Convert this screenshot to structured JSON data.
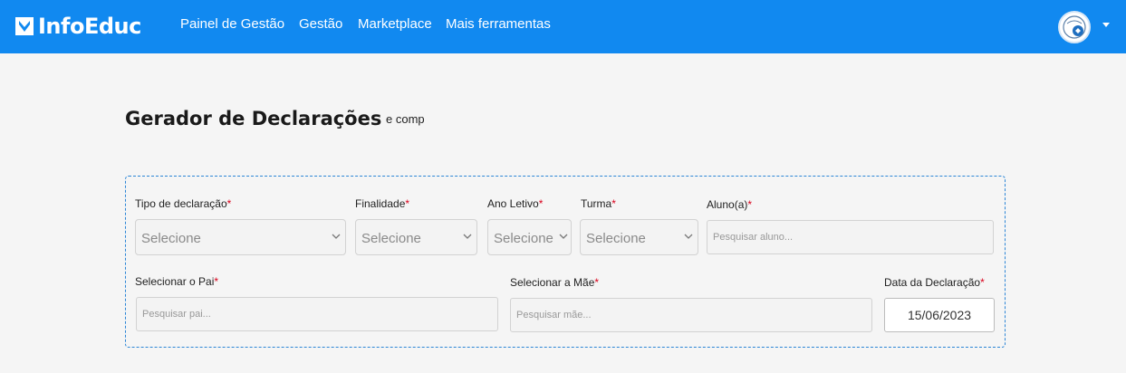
{
  "colors": {
    "navbar": "#1189f0",
    "required_mark": "#d9001b",
    "form_border": "#2b85d6"
  },
  "brand": {
    "name": "InfoEduc",
    "icon": "infoeduc-logo-icon"
  },
  "nav": {
    "links": [
      "Painel de Gestão",
      "Gestão",
      "Marketplace",
      "Mais ferramentas"
    ],
    "avatar_icon": "user-avatar-icon",
    "menu_icon": "caret-down-icon"
  },
  "page": {
    "title": "Gerador de Declarações",
    "subtitle": "e comp"
  },
  "form": {
    "required_mark": "*",
    "tipo": {
      "label": "Tipo de declaração",
      "value": "Selecione"
    },
    "finalidade": {
      "label": "Finalidade",
      "value": "Selecione"
    },
    "ano": {
      "label": "Ano Letivo",
      "value": "Selecione"
    },
    "turma": {
      "label": "Turma",
      "value": "Selecione"
    },
    "aluno": {
      "label": "Aluno(a)",
      "placeholder": "Pesquisar aluno..."
    },
    "pai": {
      "label": "Selecionar o Pai",
      "placeholder": "Pesquisar pai..."
    },
    "mae": {
      "label": "Selecionar a Mãe",
      "placeholder": "Pesquisar mãe..."
    },
    "data": {
      "label": "Data da Declaração",
      "value": "15/06/2023"
    }
  }
}
